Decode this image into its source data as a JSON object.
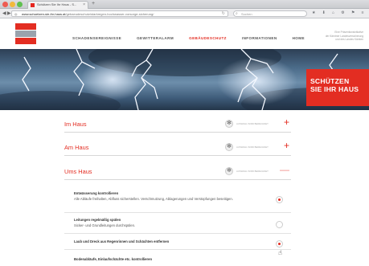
{
  "browser": {
    "tab_title": "Schützen Sie Ihr Haus - S...",
    "tab_close": "×",
    "new_tab": "+",
    "url_host": "www.schuetzen-sie-ihr-haus.at",
    "url_path": "/gebaeudeschutz/starkregen-hochwasser-vorsorge-sicherung/",
    "search_placeholder": "Suchen",
    "toolbar_icons": "★ ⬇ ⌂ ⚙ ⚑ ≡ ☰"
  },
  "site": {
    "nav": [
      {
        "label": "SCHADENSEREIGNISSE",
        "active": false
      },
      {
        "label": "GEWITTERALARM",
        "active": false
      },
      {
        "label": "GEBÄUDESCHUTZ",
        "active": true
      },
      {
        "label": "INFORMATIONEN",
        "active": false
      },
      {
        "label": "HOME",
        "active": false
      }
    ],
    "header_note_1": "Eine Präventionsinitiative",
    "header_note_2": "der Kärntner Landesversicherung",
    "header_note_3": "und des Landes Kärnten",
    "hero_line_1": "SCHÜTZEN",
    "hero_line_2": "SIE IHR HAUS"
  },
  "sections": [
    {
      "title": "Im Haus",
      "note": "AUSWAHL WIRD BERECHNET",
      "toggle": "+"
    },
    {
      "title": "Am Haus",
      "note": "AUSWAHL WIRD BERECHNET",
      "toggle": "+"
    },
    {
      "title": "Ums Haus",
      "note": "AUSWAHL WIRD BERECHNET",
      "toggle": "—"
    }
  ],
  "items": [
    {
      "title": "Entwässerung kontrollieren",
      "text": "Alle Abläufe freihalten, Abfluss sicherstellen. Verschmutzung, Ablagerungen und Verstopfungen beseitigen.",
      "checked": true
    },
    {
      "title": "Leitungen regelmäßig spülen",
      "text": "Sicker- und Grundleitungen durchspülen.",
      "checked": false
    },
    {
      "title": "Laub und Dreck aus Regenrinnen und Schächten entfernen",
      "text": "",
      "checked": true
    },
    {
      "title": "Bodenabläufe, Einlaufschächte etc. kontrollieren",
      "text": "",
      "checked": false
    }
  ]
}
